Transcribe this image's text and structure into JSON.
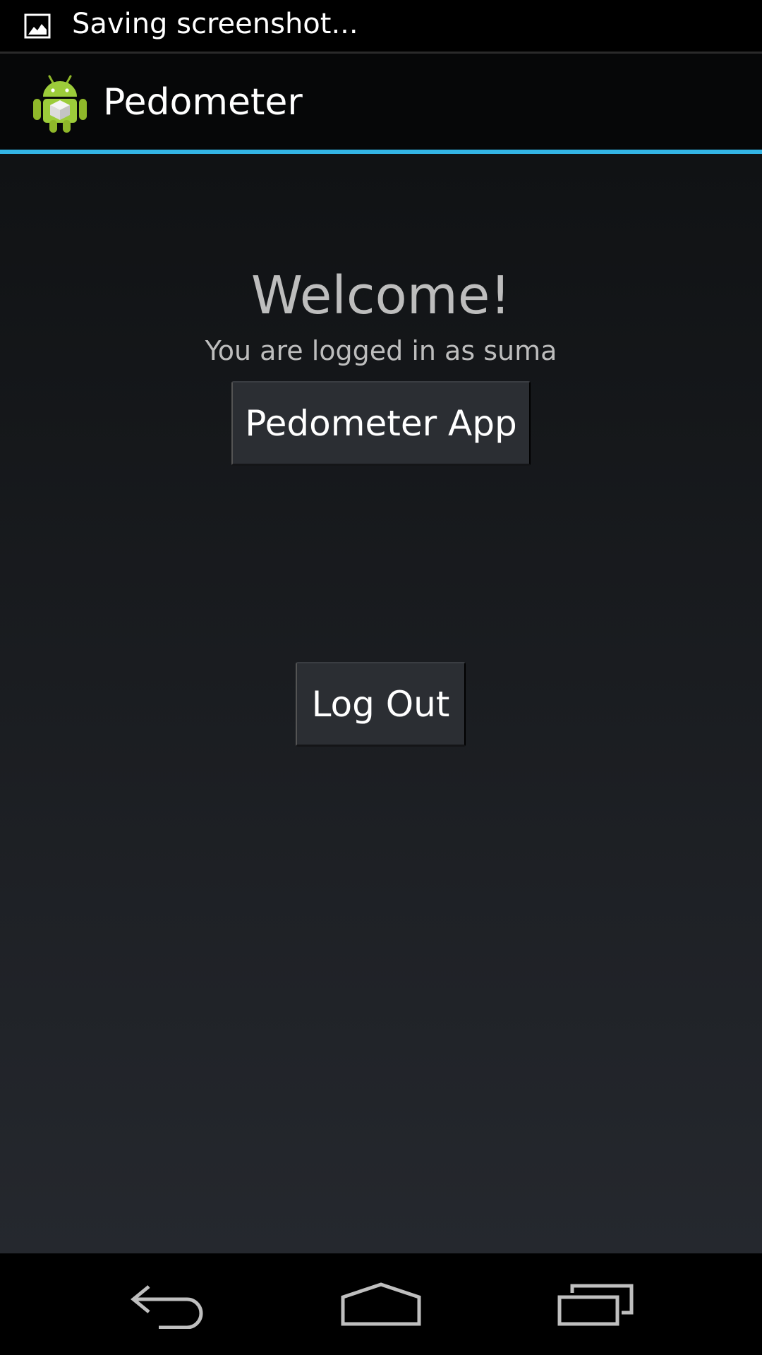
{
  "status_bar": {
    "notification_icon": "image-icon",
    "notification_text": "Saving screenshot..."
  },
  "action_bar": {
    "app_icon": "android-robot-icon",
    "title": "Pedometer",
    "accent_color": "#33b5e5"
  },
  "main": {
    "welcome": "Welcome!",
    "logged_in_text": "You are logged in as suma",
    "pedometer_button_label": "Pedometer App",
    "logout_button_label": "Log Out"
  },
  "nav_bar": {
    "back_icon": "back-arrow-icon",
    "home_icon": "home-icon",
    "recents_icon": "recent-apps-icon"
  }
}
